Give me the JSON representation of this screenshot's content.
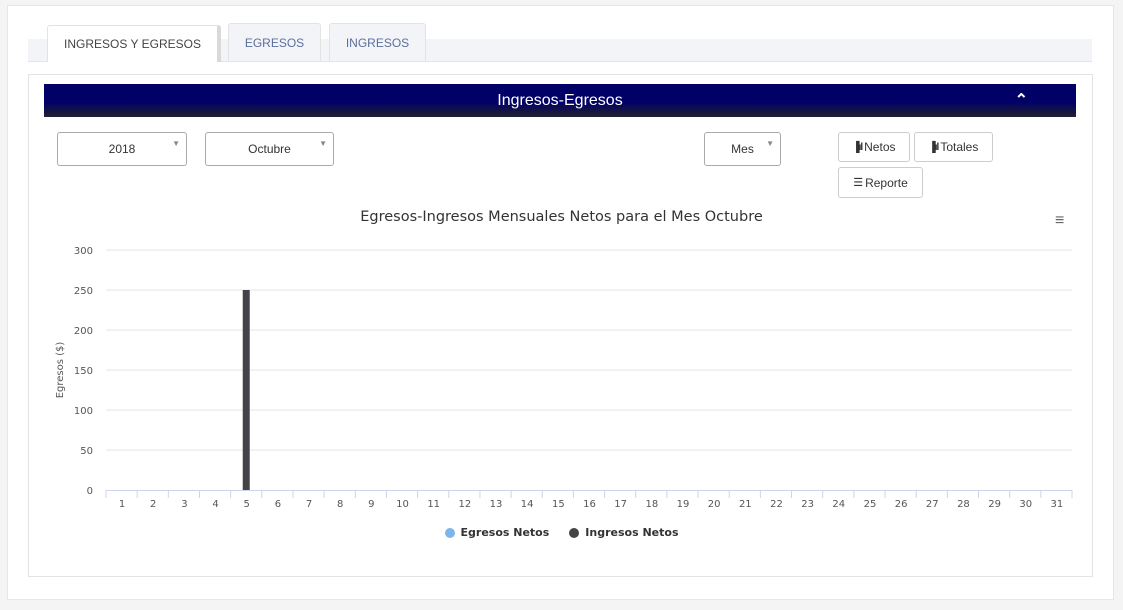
{
  "tabs": [
    {
      "label": "INGRESOS Y EGRESOS",
      "active": true
    },
    {
      "label": "EGRESOS"
    },
    {
      "label": "INGRESOS"
    }
  ],
  "panel": {
    "title": "Ingresos-Egresos",
    "collapse_icon": "chevron-up-icon"
  },
  "filters": {
    "year": "2018",
    "month": "Octubre",
    "period": "Mes"
  },
  "buttons": {
    "netos": "Netos",
    "totales": "Totales",
    "reporte": "Reporte"
  },
  "chart_menu_icon": "hamburger-icon",
  "chart_data": {
    "type": "bar",
    "title": "Egresos-Ingresos Mensuales Netos para el Mes Octubre",
    "xlabel": "",
    "ylabel": "Egresos ($)",
    "ylim": [
      0,
      300
    ],
    "yticks": [
      "0",
      "50",
      "100",
      "150",
      "200",
      "250",
      "300"
    ],
    "categories": [
      "1",
      "2",
      "3",
      "4",
      "5",
      "6",
      "7",
      "8",
      "9",
      "10",
      "11",
      "12",
      "13",
      "14",
      "15",
      "16",
      "17",
      "18",
      "19",
      "20",
      "21",
      "22",
      "23",
      "24",
      "25",
      "26",
      "27",
      "28",
      "29",
      "30",
      "31"
    ],
    "series": [
      {
        "name": "Egresos Netos",
        "color": "#7cb5ec",
        "values": [
          0,
          0,
          0,
          0,
          0,
          0,
          0,
          0,
          0,
          0,
          0,
          0,
          0,
          0,
          0,
          0,
          0,
          0,
          0,
          0,
          0,
          0,
          0,
          0,
          0,
          0,
          0,
          0,
          0,
          0,
          0
        ]
      },
      {
        "name": "Ingresos Netos",
        "color": "#434348",
        "values": [
          0,
          0,
          0,
          0,
          250,
          0,
          0,
          0,
          0,
          0,
          0,
          0,
          0,
          0,
          0,
          0,
          0,
          0,
          0,
          0,
          0,
          0,
          0,
          0,
          0,
          0,
          0,
          0,
          0,
          0,
          0
        ]
      }
    ],
    "grid": true,
    "legend": "bottom-center"
  }
}
